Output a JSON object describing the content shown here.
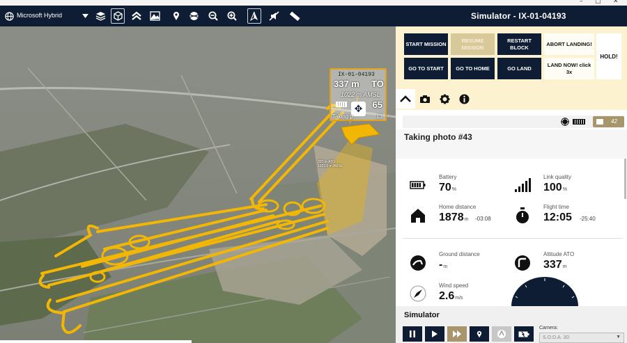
{
  "window": {
    "title": "Simulator - IX-01-04193",
    "controls": [
      "–",
      "□",
      "✕"
    ]
  },
  "toolbar": {
    "map_layer": "Microsoft Hybrid",
    "icons": [
      "dropdown-icon",
      "layers-icon",
      "3d-cube-icon",
      "chevron-up-icon",
      "terrain-icon",
      "pin-icon",
      "satellite-icon",
      "zoom-out-icon",
      "zoom-in-icon",
      "compass-icon",
      "mute-icon",
      "ruler-icon"
    ]
  },
  "map": {
    "drone_card": {
      "id": "IX-01-04193",
      "altitude_ato": "337 m",
      "ato_tag": "TO",
      "msl": "1022 m AMSL",
      "big_value": "65",
      "taking": "Taking p",
      "photo_num": "13"
    },
    "marker_label": [
      "337 m ATO",
      "1021.0 m AMSL"
    ]
  },
  "commands": {
    "start_mission": "START MISSION",
    "resume_mission": "RESUME MISSION",
    "restart_block": "RESTART BLOCK",
    "abort_landing": "ABORT LANDING!",
    "go_to_start": "GO TO START",
    "go_to_home": "GO TO HOME",
    "go_land": "GO LAND",
    "land_now": "LAND NOW! click 3x",
    "hold": "HOLD!"
  },
  "tabs": [
    "flight-tab",
    "camera-tab",
    "settings-tab",
    "info-tab"
  ],
  "status": {
    "photo_count": "42",
    "message": "Taking photo #43"
  },
  "telemetry": {
    "battery": {
      "label": "Battery",
      "value": "70",
      "unit": "%"
    },
    "link": {
      "label": "Link quality",
      "value": "100",
      "unit": "%"
    },
    "home_distance": {
      "label": "Home distance",
      "value": "1878",
      "unit": "m",
      "extra": "-03:08"
    },
    "flight_time": {
      "label": "Flight time",
      "value": "12:05",
      "extra": "-25:40"
    },
    "ground_distance": {
      "label": "Ground distance",
      "value": "-",
      "unit": "m"
    },
    "altitude_ato": {
      "label": "Altitude ATO",
      "value": "337",
      "unit": "m"
    },
    "wind_speed": {
      "label": "Wind speed",
      "value": "2.6",
      "unit": "m/s"
    }
  },
  "simulator": {
    "title": "Simulator",
    "camera_label": "Camera:",
    "camera_value": "S.O.D.A. 3D"
  },
  "colors": {
    "navy": "#0e1d33",
    "accent": "#e3a21a",
    "panel_bg": "#fdf2cf",
    "tan": "#a7956c"
  }
}
